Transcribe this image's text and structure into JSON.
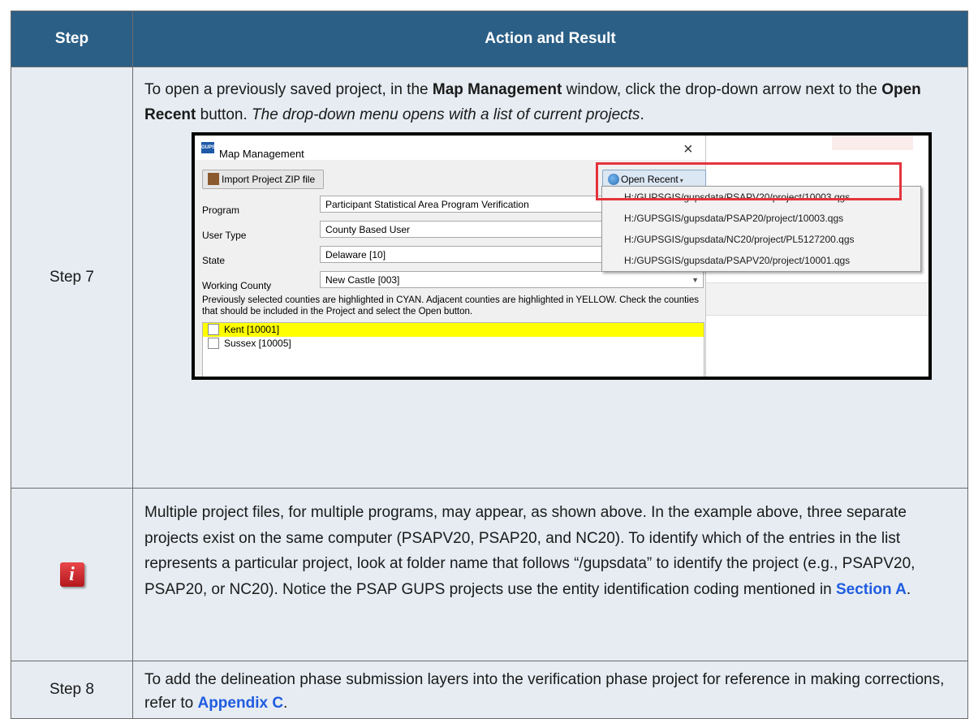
{
  "table": {
    "headers": {
      "step": "Step",
      "action": "Action and Result"
    },
    "rows": [
      {
        "step": "Step 7",
        "text": {
          "p1": "To open a previously saved project, in the ",
          "b1": "Map Management",
          "p2": " window, click the drop-down arrow next to the ",
          "b2": "Open Recent",
          "p3": " button. ",
          "i1": "The drop-down menu opens with a list of current projects",
          "p4": "."
        },
        "screenshot": {
          "window_title": "Map Management",
          "app_icon_text": "GUPS",
          "close_glyph": "×",
          "import_button": "Import Project ZIP file",
          "open_recent_button": "Open Recent",
          "caret": "▾",
          "fields": [
            {
              "label": "Program",
              "value": "Participant Statistical Area Program Verification"
            },
            {
              "label": "User Type",
              "value": "County Based User"
            },
            {
              "label": "State",
              "value": "Delaware [10]"
            },
            {
              "label": "Working County",
              "value": "New Castle [003]"
            }
          ],
          "dropdown_arrow": "▼",
          "note": "Previously selected counties are highlighted in CYAN. Adjacent counties are highlighted in YELLOW. Check the counties that should be included in the Project and select the Open button.",
          "counties": [
            {
              "name": "Kent [10001]",
              "highlight": "#ffff00"
            },
            {
              "name": "Sussex [10005]",
              "highlight": ""
            }
          ],
          "recent_projects": [
            "H:/GUPSGIS/gupsdata/PSAPV20/project/10003.qgs",
            "H:/GUPSGIS/gupsdata/PSAP20/project/10003.qgs",
            "H:/GUPSGIS/gupsdata/NC20/project/PL5127200.qgs",
            "H:/GUPSGIS/gupsdata/PSAPV20/project/10001.qgs"
          ]
        }
      },
      {
        "step_icon": "info-icon",
        "info_glyph": "i",
        "text": {
          "p1": "Multiple project files, for multiple programs, may appear, as shown above. In the example above, three separate projects exist on the same computer (PSAPV20, PSAP20, and NC20). To identify which of the entries in the list represents a particular project, look at folder name that follows “/gupsdata” to identify the project (e.g., PSAPV20, PSAP20, or NC20). Notice the PSAP GUPS projects use the entity identification coding mentioned in ",
          "link": "Section A",
          "p2": "."
        }
      },
      {
        "step": "Step 8",
        "text": {
          "p1": "To add the delineation phase submission layers into the verification phase project for reference in making corrections, refer to ",
          "link": "Appendix C",
          "p2": "."
        }
      }
    ]
  },
  "colors": {
    "header_bg": "#2b5f86",
    "cell_bg": "#e6ecf2",
    "link": "#1f5ce0",
    "highlight_box": "#e6333c",
    "county_highlight": "#ffff00"
  }
}
